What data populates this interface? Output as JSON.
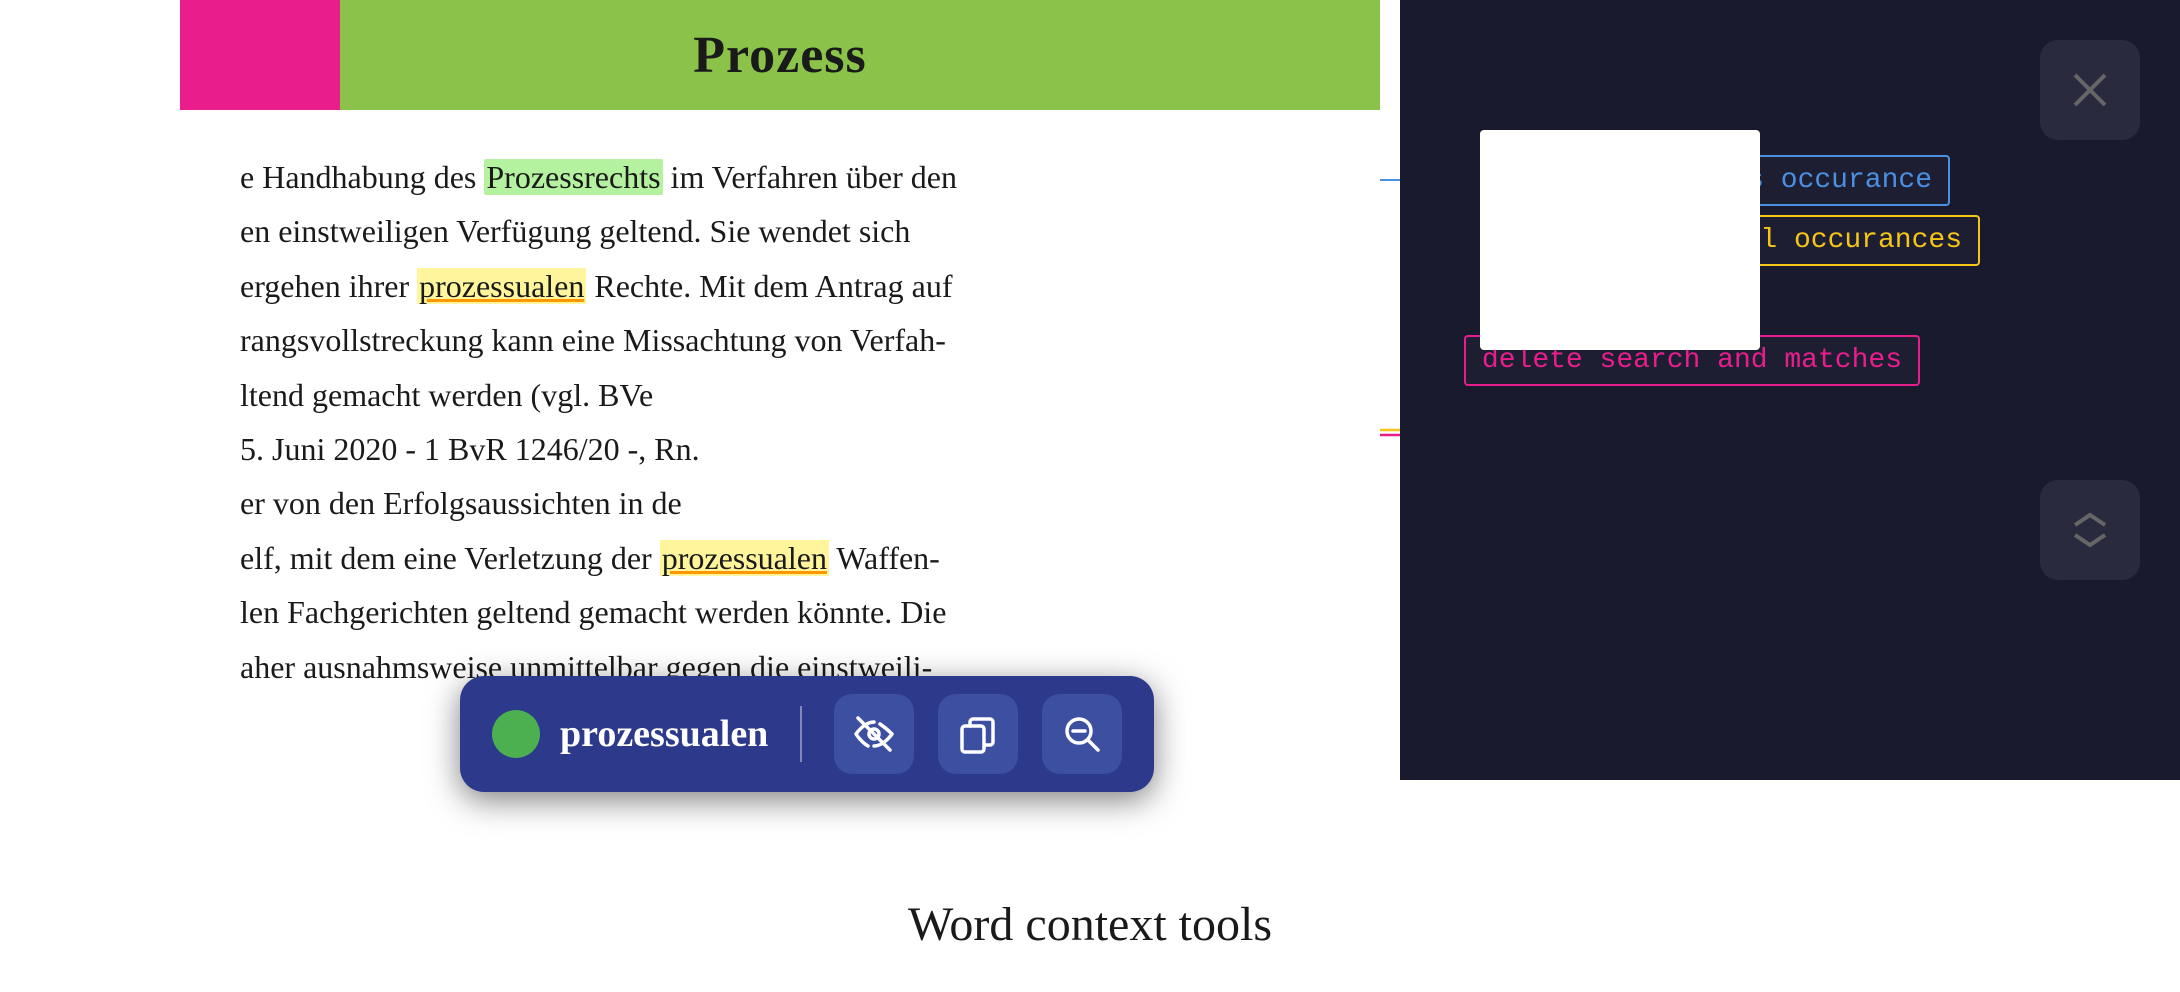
{
  "header": {
    "title": "Prozess",
    "accent_color": "#8bc34a",
    "pink_color": "#e91e8c"
  },
  "document": {
    "lines": [
      "e Handhabung des ",
      " im Verfahren über den",
      "en einstweiligen Verfügung geltend. Sie wendet sich",
      "ergehen ihrer ",
      " Rechte. Mit dem Antrag auf",
      "rangsvollstreckung kann eine Missachtung von Verfah-",
      "ltend gemacht werden (vgl. BVe",
      "5. Juni 2020 - 1 BvR 1246/20 -, Rn.",
      "er von den Erfolgsaussichten in de",
      "elf, mit dem eine Verletzung der ",
      " Waffen-",
      "len Fachgerichten geltend gemacht werden könnte. Die",
      "aher ausnahmsweise unmittelbar gegen die einsteili-"
    ],
    "highlight1_word": "Prozessrechts",
    "highlight2_word": "prozessualen",
    "highlight3_word": "prozessualen"
  },
  "annotations": {
    "blue_label": "ignore this occurance",
    "yellow_label": "ignore all occurances",
    "pink_label": "delete search and  matches"
  },
  "toolbar": {
    "dot_color": "#4caf50",
    "word": "prozessualen",
    "btn1_label": "ignore-icon",
    "btn2_label": "copy-icon",
    "btn3_label": "zoom-out-icon"
  },
  "footer": {
    "caption": "Word context tools"
  },
  "colors": {
    "blue_annotation": "#4a90e2",
    "yellow_annotation": "#f5c518",
    "pink_annotation": "#e91e8c",
    "toolbar_bg": "#2d3a8c",
    "toolbar_btn_bg": "#3d4fa0",
    "right_panel_bg": "#1a1a2e"
  }
}
